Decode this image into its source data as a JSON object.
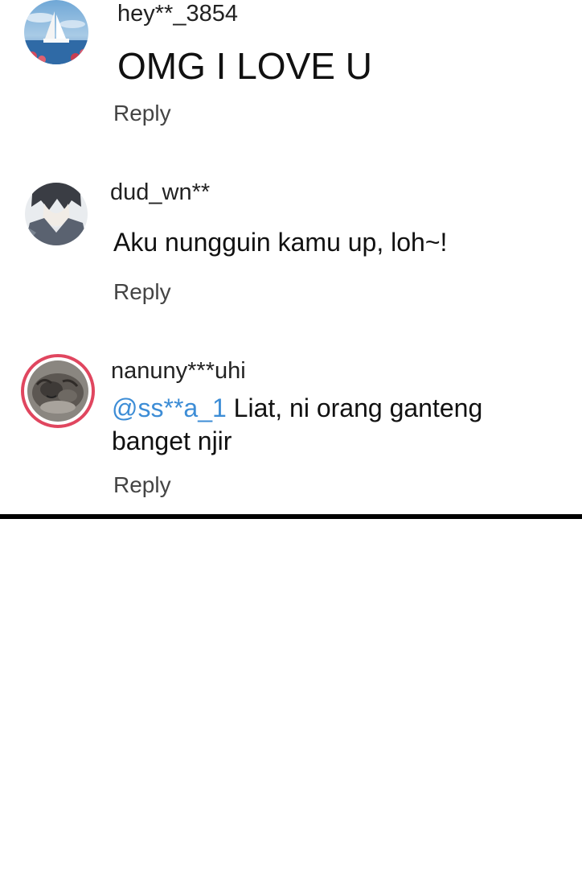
{
  "comments": [
    {
      "username": "hey**_3854",
      "text": "OMG I LOVE U",
      "reply_label": "Reply",
      "avatar_icon": "sailboat-photo-avatar"
    },
    {
      "username": "dud_wn**",
      "text": "Aku nungguin kamu up, loh~!",
      "reply_label": "Reply",
      "avatar_icon": "anime-character-avatar"
    },
    {
      "username": "nanuny***uhi",
      "mention": "@ss**a_1",
      "text_line1": "Liat, ni orang ganteng",
      "text_line2": "banget njir",
      "reply_label": "Reply",
      "avatar_icon": "cat-photo-avatar",
      "avatar_ring_color": "#e0465f"
    }
  ],
  "colors": {
    "mention": "#3d8dd6",
    "divider": "#000000",
    "avatar_ring": "#e0465f"
  }
}
